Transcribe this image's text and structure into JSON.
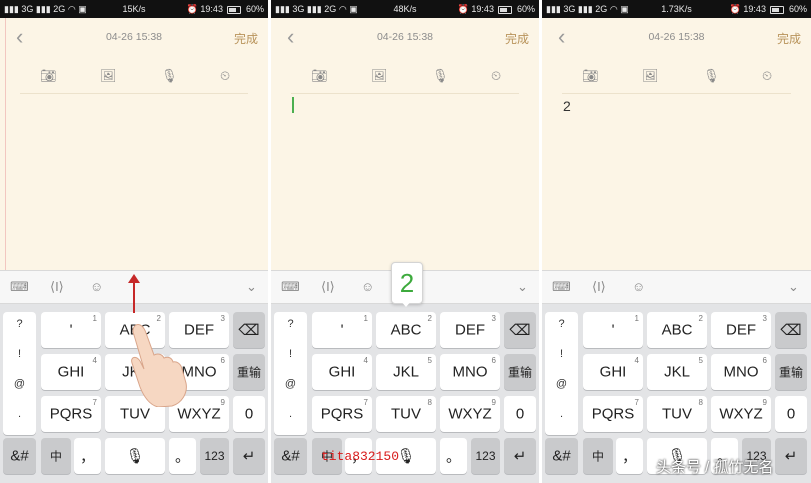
{
  "panels": [
    {
      "status": {
        "signal_text": "3G",
        "signal2_text": "2G",
        "speed": "15K/s",
        "time": "19:43",
        "battery": "60%"
      },
      "header": {
        "date": "04-26 15:38",
        "done": "完成"
      },
      "body_text": "",
      "show_cursor": false
    },
    {
      "status": {
        "signal_text": "3G",
        "signal2_text": "2G",
        "speed": "48K/s",
        "time": "19:43",
        "battery": "60%"
      },
      "header": {
        "date": "04-26 15:38",
        "done": "完成"
      },
      "body_text": "",
      "show_cursor": true
    },
    {
      "status": {
        "signal_text": "3G",
        "signal2_text": "2G",
        "speed": "1.73K/s",
        "time": "19:43",
        "battery": "60%"
      },
      "header": {
        "date": "04-26 15:38",
        "done": "完成"
      },
      "body_text": "2",
      "show_cursor": false
    }
  ],
  "keyboard": {
    "row1": [
      {
        "label": "'",
        "num": "1"
      },
      {
        "label": "ABC",
        "num": "2"
      },
      {
        "label": "DEF",
        "num": "3"
      }
    ],
    "row2": [
      {
        "label": "GHI",
        "num": "4"
      },
      {
        "label": "JKL",
        "num": "5"
      },
      {
        "label": "MNO",
        "num": "6"
      }
    ],
    "row3": [
      {
        "label": "PQRS",
        "num": "7"
      },
      {
        "label": "TUV",
        "num": "8"
      },
      {
        "label": "WXYZ",
        "num": "9"
      }
    ],
    "symbols": [
      "?",
      "!",
      "@",
      "."
    ],
    "reenter": "重输",
    "zero": "0",
    "sym_key": "&#",
    "zh_key": "中",
    "comma_key": "，",
    "period_key": "。",
    "num_key": "123"
  },
  "popup_digit": "2",
  "watermark_red": "tita832150",
  "watermark": "头条号 / 孤竹无名",
  "icons": {
    "status": [
      "signal-icon",
      "wifi-icon",
      "image-icon",
      "alarm-icon",
      "battery-icon"
    ],
    "toolbar": [
      "camera-icon",
      "picture-icon",
      "microphone-icon",
      "clock-icon"
    ],
    "keyboard_bar": [
      "keyboard-icon",
      "cursor-move-icon",
      "emoji-icon",
      "chevron-down-icon"
    ],
    "keys": [
      "backspace-icon",
      "microphone-icon",
      "enter-icon"
    ]
  },
  "colors": {
    "note_bg": "#fcf5e6",
    "accent": "#b8935a",
    "arrow": "#c62828",
    "popup_digit": "#3daa3d",
    "cursor": "#4caf50"
  }
}
